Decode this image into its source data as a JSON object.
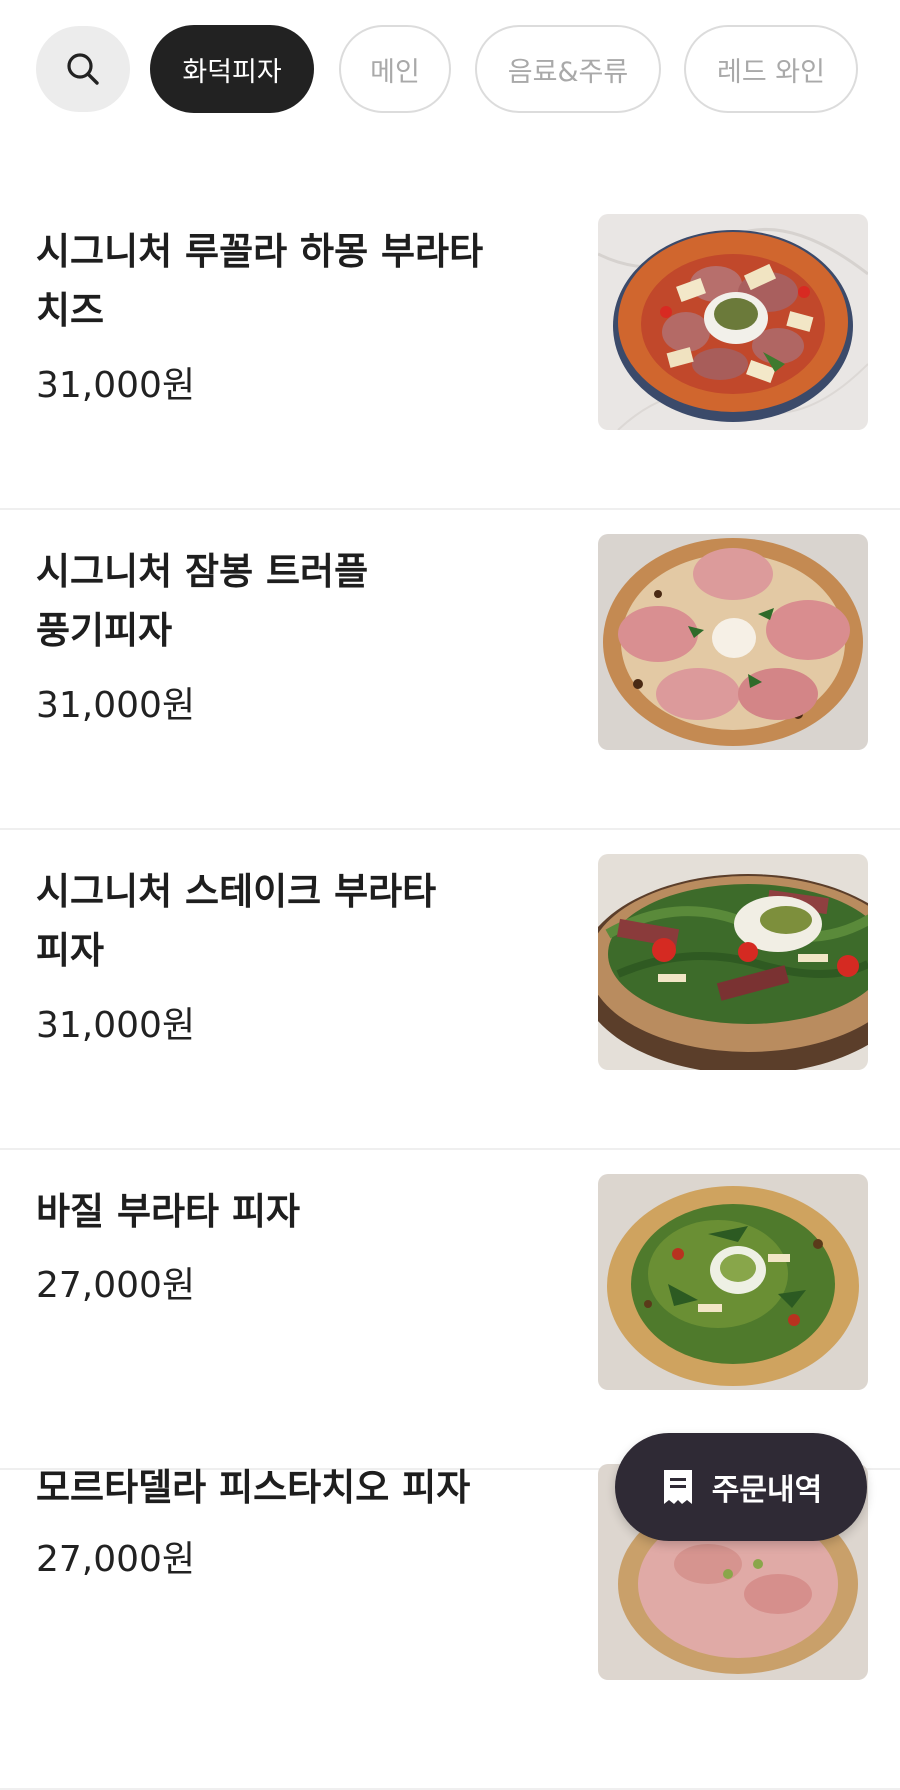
{
  "category_tabs": [
    {
      "label": "화덕피자",
      "active": true
    },
    {
      "label": "메인",
      "active": false
    },
    {
      "label": "음료&주류",
      "active": false
    },
    {
      "label": "레드 와인",
      "active": false
    }
  ],
  "search": {
    "icon": "search-icon"
  },
  "menu_items": [
    {
      "name": "시그니처 루꼴라 하몽 부라타 치즈",
      "price": "31,000원",
      "photo": "pizza-prosciutto-burrata"
    },
    {
      "name": "시그니처 잠봉 트러플 풍기피자",
      "price": "31,000원",
      "photo": "pizza-jambon-truffle"
    },
    {
      "name": "시그니처 스테이크 부라타 피자",
      "price": "31,000원",
      "photo": "pizza-steak-burrata"
    },
    {
      "name": "바질 부라타 피자",
      "price": "27,000원",
      "photo": "pizza-basil-burrata"
    },
    {
      "name": "모르타델라 피스타치오 피자",
      "price": "27,000원",
      "photo": "pizza-mortadella-pistachio"
    }
  ],
  "order_button": {
    "label": "주문내역",
    "icon": "receipt-icon"
  },
  "colors": {
    "active_tab": "#222222",
    "fab": "#2f2a35"
  }
}
